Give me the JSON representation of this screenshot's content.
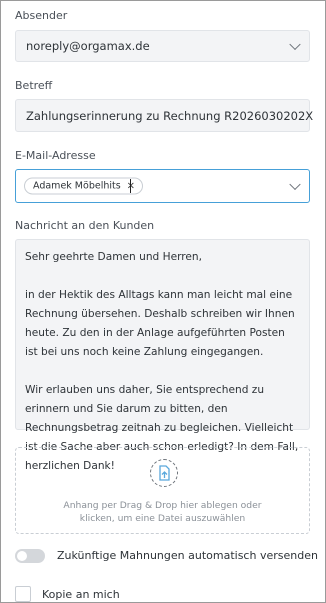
{
  "sender": {
    "label": "Absender",
    "value": "noreply@orgamax.de"
  },
  "subject": {
    "label": "Betreff",
    "value": "Zahlungserinnerung zu Rechnung R2026030202X"
  },
  "email": {
    "label": "E-Mail-Adresse",
    "chips": [
      "Adamek Möbelhits"
    ],
    "chip_remove": "×"
  },
  "message": {
    "label": "Nachricht an den Kunden",
    "paragraphs": [
      "Sehr geehrte Damen und Herren,",
      "in der Hektik des Alltags kann man leicht mal eine Rechnung übersehen. Deshalb schreiben wir Ihnen heute. Zu den in der Anlage aufgeführten Posten ist bei uns noch keine Zahlung eingegangen.",
      "Wir erlauben uns daher, Sie entsprechend zu erinnern und Sie darum zu bitten, den Rechnungsbetrag zeitnah zu begleichen. Vielleicht ist die Sache aber auch schon erledigt? In dem Fall, herzlichen Dank!"
    ]
  },
  "attachment": {
    "icon": "file-upload-icon",
    "line1": "Anhang per Drag & Drop hier ablegen oder",
    "line2": "klicken, um eine Datei auszuwählen"
  },
  "auto_reminder": {
    "label": "Zukünftige Mahnungen automatisch versenden",
    "enabled": false
  },
  "copy_to_me": {
    "label": "Kopie an mich",
    "checked": false
  },
  "colors": {
    "accent": "#46a0d8",
    "field_bg": "#f3f4f6",
    "toggle_off": "#d4d7db"
  }
}
